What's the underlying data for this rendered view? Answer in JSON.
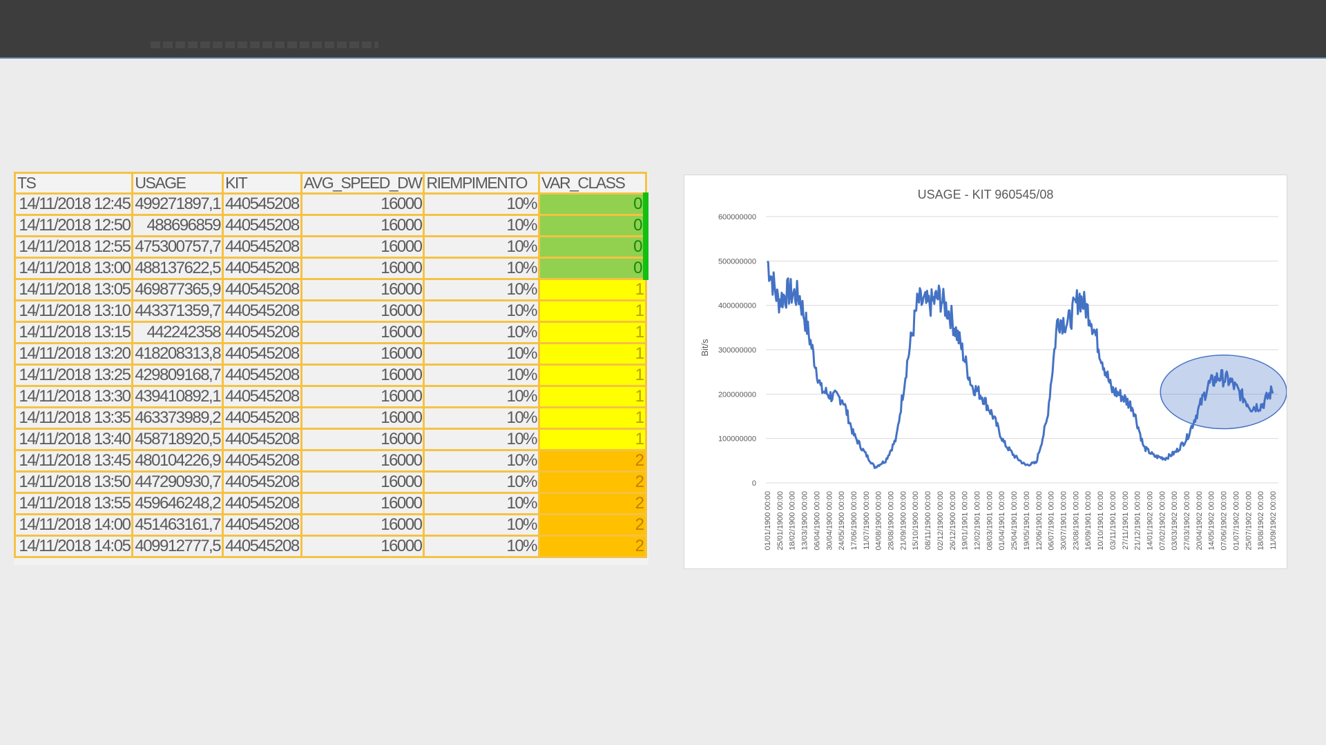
{
  "table": {
    "headers": [
      "TS",
      "USAGE",
      "KIT",
      "AVG_SPEED_DW",
      "RIEMPIMENTO",
      "VAR_CLASS"
    ],
    "rows": [
      {
        "ts": "14/11/2018 12:45",
        "usage": "499271897,1",
        "kit": "440545208",
        "avg": "16000",
        "riemp": "10%",
        "var": "0"
      },
      {
        "ts": "14/11/2018 12:50",
        "usage": "488696859",
        "kit": "440545208",
        "avg": "16000",
        "riemp": "10%",
        "var": "0"
      },
      {
        "ts": "14/11/2018 12:55",
        "usage": "475300757,7",
        "kit": "440545208",
        "avg": "16000",
        "riemp": "10%",
        "var": "0"
      },
      {
        "ts": "14/11/2018 13:00",
        "usage": "488137622,5",
        "kit": "440545208",
        "avg": "16000",
        "riemp": "10%",
        "var": "0"
      },
      {
        "ts": "14/11/2018 13:05",
        "usage": "469877365,9",
        "kit": "440545208",
        "avg": "16000",
        "riemp": "10%",
        "var": "1"
      },
      {
        "ts": "14/11/2018 13:10",
        "usage": "443371359,7",
        "kit": "440545208",
        "avg": "16000",
        "riemp": "10%",
        "var": "1"
      },
      {
        "ts": "14/11/2018 13:15",
        "usage": "442242358",
        "kit": "440545208",
        "avg": "16000",
        "riemp": "10%",
        "var": "1"
      },
      {
        "ts": "14/11/2018 13:20",
        "usage": "418208313,8",
        "kit": "440545208",
        "avg": "16000",
        "riemp": "10%",
        "var": "1"
      },
      {
        "ts": "14/11/2018 13:25",
        "usage": "429809168,7",
        "kit": "440545208",
        "avg": "16000",
        "riemp": "10%",
        "var": "1"
      },
      {
        "ts": "14/11/2018 13:30",
        "usage": "439410892,1",
        "kit": "440545208",
        "avg": "16000",
        "riemp": "10%",
        "var": "1"
      },
      {
        "ts": "14/11/2018 13:35",
        "usage": "463373989,2",
        "kit": "440545208",
        "avg": "16000",
        "riemp": "10%",
        "var": "1"
      },
      {
        "ts": "14/11/2018 13:40",
        "usage": "458718920,5",
        "kit": "440545208",
        "avg": "16000",
        "riemp": "10%",
        "var": "1"
      },
      {
        "ts": "14/11/2018 13:45",
        "usage": "480104226,9",
        "kit": "440545208",
        "avg": "16000",
        "riemp": "10%",
        "var": "2"
      },
      {
        "ts": "14/11/2018 13:50",
        "usage": "447290930,7",
        "kit": "440545208",
        "avg": "16000",
        "riemp": "10%",
        "var": "2"
      },
      {
        "ts": "14/11/2018 13:55",
        "usage": "459646248,2",
        "kit": "440545208",
        "avg": "16000",
        "riemp": "10%",
        "var": "2"
      },
      {
        "ts": "14/11/2018 14:00",
        "usage": "451463161,7",
        "kit": "440545208",
        "avg": "16000",
        "riemp": "10%",
        "var": "2"
      },
      {
        "ts": "14/11/2018 14:05",
        "usage": "409912777,5",
        "kit": "440545208",
        "avg": "16000",
        "riemp": "10%",
        "var": "2"
      }
    ],
    "class_colors": {
      "0": "#92d050",
      "1": "#ffff00",
      "2": "#ffc000"
    }
  },
  "chart_data": {
    "type": "line",
    "title": "USAGE - KIT 960545/08",
    "ylabel": "Bit/s",
    "xlabel": "",
    "ylim": [
      0,
      600000000
    ],
    "yticks": [
      "0",
      "100000000",
      "200000000",
      "300000000",
      "400000000",
      "500000000",
      "600000000"
    ],
    "grid": true,
    "line_color": "#4472c4",
    "highlight": {
      "shape": "ellipse",
      "color": "#4472c4",
      "x_range": [
        "03/03/1902 00:00",
        "11/09/1902 00:00"
      ],
      "y_range": [
        150000000,
        260000000
      ]
    },
    "x": [
      "01/01/1900 00:00",
      "25/01/1900 00:00",
      "18/02/1900 00:00",
      "13/03/1900 00:00",
      "06/04/1900 00:00",
      "30/04/1900 00:00",
      "24/05/1900 00:00",
      "17/06/1900 00:00",
      "11/07/1900 00:00",
      "04/08/1900 00:00",
      "28/08/1900 00:00",
      "21/09/1900 00:00",
      "15/10/1900 00:00",
      "08/11/1900 00:00",
      "02/12/1900 00:00",
      "26/12/1900 00:00",
      "19/01/1901 00:00",
      "12/02/1901 00:00",
      "08/03/1901 00:00",
      "01/04/1901 00:00",
      "25/04/1901 00:00",
      "19/05/1901 00:00",
      "12/06/1901 00:00",
      "06/07/1901 00:00",
      "30/07/1901 00:00",
      "23/08/1901 00:00",
      "16/09/1901 00:00",
      "10/10/1901 00:00",
      "03/11/1901 00:00",
      "27/11/1901 00:00",
      "21/12/1901 00:00",
      "14/01/1902 00:00",
      "07/02/1902 00:00",
      "03/03/1902 00:00",
      "27/03/1902 00:00",
      "20/04/1902 00:00",
      "14/05/1902 00:00",
      "07/06/1902 00:00",
      "01/07/1902 00:00",
      "25/07/1902 00:00",
      "18/08/1902 00:00",
      "11/09/1902 00:00"
    ],
    "values": [
      500000000,
      410000000,
      430000000,
      420000000,
      320000000,
      210000000,
      195000000,
      190000000,
      110000000,
      70000000,
      35000000,
      50000000,
      100000000,
      270000000,
      410000000,
      400000000,
      420000000,
      380000000,
      310000000,
      220000000,
      195000000,
      150000000,
      90000000,
      60000000,
      40000000,
      45000000,
      140000000,
      370000000,
      360000000,
      420000000,
      380000000,
      290000000,
      210000000,
      195000000,
      170000000,
      80000000,
      60000000,
      55000000,
      70000000,
      100000000,
      160000000,
      220000000,
      240000000,
      230000000,
      200000000,
      170000000,
      175000000,
      210000000
    ]
  }
}
